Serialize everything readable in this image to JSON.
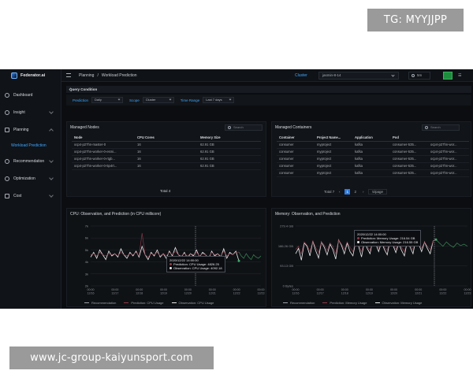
{
  "watermark": {
    "top": "TG: MYYJJPP",
    "bottom": "www.jc-group-kaiyunsport.com"
  },
  "brand": {
    "name": "Federator.ai"
  },
  "sidebar": {
    "items": [
      {
        "label": "Dashboard",
        "icon": "dashboard-icon"
      },
      {
        "label": "Insight",
        "icon": "insight-icon"
      },
      {
        "label": "Planning",
        "icon": "planning-icon"
      },
      {
        "label": "Workload Prediction",
        "icon": ""
      },
      {
        "label": "Recommendation",
        "icon": "recommendation-icon"
      },
      {
        "label": "Optimization",
        "icon": "optimization-icon"
      },
      {
        "label": "Cost",
        "icon": "cost-icon"
      }
    ]
  },
  "topbar": {
    "breadcrumb": [
      "Planning",
      "/",
      "Workload Prediction"
    ],
    "cluster_label": "Cluster",
    "cluster_value": "jasmin-8-14",
    "refresh_label": "5m"
  },
  "query": {
    "title": "Query Condition",
    "prediction_label": "Prediction",
    "prediction_value": "Daily",
    "scope_label": "Scope",
    "scope_value": "Cluster",
    "time_range_label": "Time Range",
    "time_range_value": "Last 7 days"
  },
  "nodes": {
    "title": "Managed Nodes",
    "search_placeholder": "Search",
    "columns": [
      "Node",
      "CPU Cores",
      "Memory Size"
    ],
    "rows": [
      [
        "ocp4-p27hn-master-0",
        "16",
        "62.91 GB"
      ],
      [
        "ocp4-p27hn-worker-0-esmi...",
        "16",
        "62.91 GB"
      ],
      [
        "ocp4-p27hn-worker-0-rtgb...",
        "16",
        "62.91 GB"
      ],
      [
        "ocp4-p27hn-worker-0-5p4rt...",
        "16",
        "62.91 GB"
      ]
    ],
    "total": "Total 4"
  },
  "containers": {
    "title": "Managed Containers",
    "search_placeholder": "Search",
    "columns": [
      "Container",
      "Project Name...",
      "Application",
      "Pod"
    ],
    "rows": [
      [
        "consumer",
        "myproject",
        "kafka",
        "consumer-535...",
        "ocp4-p27hn-wor..."
      ],
      [
        "consumer",
        "myproject",
        "kafka",
        "consumer-535...",
        "ocp4-p27hn-wor..."
      ],
      [
        "consumer",
        "myproject",
        "kafka",
        "consumer-535...",
        "ocp4-p27hn-wor..."
      ],
      [
        "consumer",
        "myproject",
        "kafka",
        "consumer-535...",
        "ocp4-p27hn-wor..."
      ],
      [
        "consumer",
        "myproject",
        "kafka",
        "consumer-535...",
        "ocp4-p27hn-wor..."
      ]
    ],
    "total": "Total 7",
    "pages": [
      "1",
      "2"
    ],
    "active_page": "1",
    "page_size": "5/page"
  },
  "cpu_chart": {
    "title": "CPU: Observation, and Prediction (in CPU millicore)",
    "tooltip": {
      "time": "2020/12/22 14:00:00",
      "prediction": "Prediction: CPU Usage: 4826.25",
      "observation": "Observation: CPU Usage: 4092.18"
    },
    "legend": [
      "Recommendation",
      "Prediction: CPU Usage",
      "Observation: CPU Usage"
    ]
  },
  "mem_chart": {
    "title": "Memory: Observation, and Prediction",
    "tooltip": {
      "time": "2020/12/22 14:00:00",
      "prediction": "Prediction: Memory Usage: 216.54 GB",
      "observation": "Observation: Memory Usage: 216.55 GB"
    },
    "legend": [
      "Recommendation",
      "Prediction: Memory Usage",
      "Observation: Memory Usage"
    ]
  },
  "chart_data": [
    {
      "type": "line",
      "title": "CPU: Observation, and Prediction (in CPU millicore)",
      "ytick_labels": [
        "7k",
        "6k",
        "5k",
        "4k",
        "3k",
        "2k"
      ],
      "ylim": [
        2000,
        7000
      ],
      "xtick_labels": [
        "00:00 12/16",
        "00:00 12/17",
        "00:00 12/18",
        "00:00 12/19",
        "00:00 12/20",
        "00:00 12/21",
        "00:00 12/22",
        "00:00 12/23"
      ],
      "series": [
        {
          "name": "Observation: CPU Usage",
          "color": "#e9e9ea",
          "values": [
            4400,
            4800,
            4300,
            5000,
            4600,
            4200,
            4900,
            4500,
            4700,
            4400,
            5100,
            4600,
            4300,
            4800,
            4500,
            4900,
            4400,
            5300,
            4600,
            4200,
            4800,
            4500,
            5000,
            4400,
            4700,
            4300,
            4900,
            4500,
            5200,
            4600,
            4400,
            4800,
            4300,
            4700,
            4500,
            5000,
            4400,
            4800,
            4600,
            4200,
            4900,
            4500,
            4700,
            4400,
            5100,
            4300,
            4800,
            4600,
            4900,
            4092
          ]
        },
        {
          "name": "Prediction: CPU Usage",
          "color": "#8e3b4a",
          "values": [
            4600,
            4700,
            4500,
            4800,
            4600,
            4500,
            4700,
            4600,
            4700,
            4500,
            4800,
            4600,
            4500,
            4700,
            4600,
            4800,
            4500,
            6400,
            4600,
            4400,
            4700,
            4600,
            4800,
            4500,
            4700,
            4500,
            4800,
            4600,
            4900,
            4600,
            4500,
            4700,
            4500,
            4700,
            4600,
            4800,
            4500,
            4700,
            4600,
            4400,
            4800,
            4600,
            4700,
            4500,
            4900,
            4500,
            4700,
            4600,
            4800,
            4826
          ]
        },
        {
          "name": "Future prediction",
          "color": "#3a8a57",
          "values": [
            4826,
            4500,
            4300,
            4700,
            4400,
            4200,
            4600,
            4400,
            4300,
            4500
          ]
        }
      ]
    },
    {
      "type": "line",
      "title": "Memory: Observation, and Prediction",
      "ytick_labels": [
        "279.4 GB",
        "186.26 GB",
        "93.13 GB",
        "0 Bytes"
      ],
      "xtick_labels": [
        "00:00 12/16",
        "00:00 12/17",
        "00:00 12/18",
        "00:00 12/19",
        "00:00 12/20",
        "00:00 12/21",
        "00:00 12/22",
        "00:00 12/23"
      ],
      "series": [
        {
          "name": "Observation: Memory Usage",
          "color": "#e9e9ea",
          "values": [
            150,
            175,
            120,
            200,
            185,
            140,
            210,
            165,
            130,
            205,
            180,
            145,
            195,
            170,
            125,
            215,
            190,
            150,
            200,
            160,
            140,
            210,
            185,
            135,
            205,
            175,
            150,
            220,
            195,
            160,
            205,
            170,
            145,
            215,
            190,
            155,
            200,
            165,
            140,
            210,
            180,
            150,
            220,
            195,
            160,
            205,
            175,
            150,
            210,
            216
          ]
        },
        {
          "name": "Prediction: Memory Usage",
          "color": "#8e3b4a",
          "values": [
            170,
            185,
            150,
            205,
            190,
            160,
            210,
            180,
            155,
            205,
            190,
            165,
            200,
            185,
            150,
            215,
            195,
            170,
            205,
            180,
            160,
            210,
            190,
            160,
            205,
            185,
            165,
            215,
            200,
            175,
            205,
            180,
            165,
            215,
            195,
            170,
            205,
            180,
            160,
            210,
            190,
            170,
            215,
            200,
            175,
            205,
            185,
            170,
            210,
            216.5
          ]
        },
        {
          "name": "Future prediction",
          "color": "#3a8a57",
          "values": [
            216,
            200,
            185,
            205,
            190,
            180,
            200,
            188,
            195,
            185
          ]
        }
      ]
    }
  ]
}
